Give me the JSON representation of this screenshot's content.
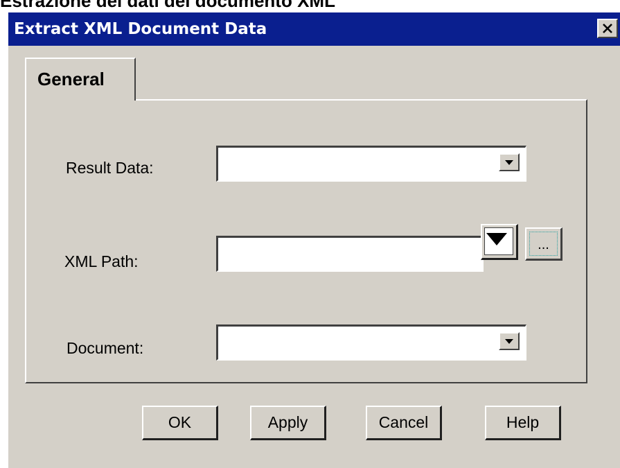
{
  "page_caption": "Estrazione dei dati del documento XML",
  "window": {
    "title": "Extract XML Document Data",
    "close_icon": "close-x-icon"
  },
  "tabs": [
    {
      "label": "General",
      "selected": true
    }
  ],
  "form": {
    "result_data": {
      "label": "Result Data:",
      "value": ""
    },
    "xml_path": {
      "label": "XML Path:",
      "value": "",
      "browse_label": "..."
    },
    "document": {
      "label": "Document:",
      "value": ""
    }
  },
  "buttons": {
    "ok": "OK",
    "apply": "Apply",
    "cancel": "Cancel",
    "help": "Help"
  }
}
